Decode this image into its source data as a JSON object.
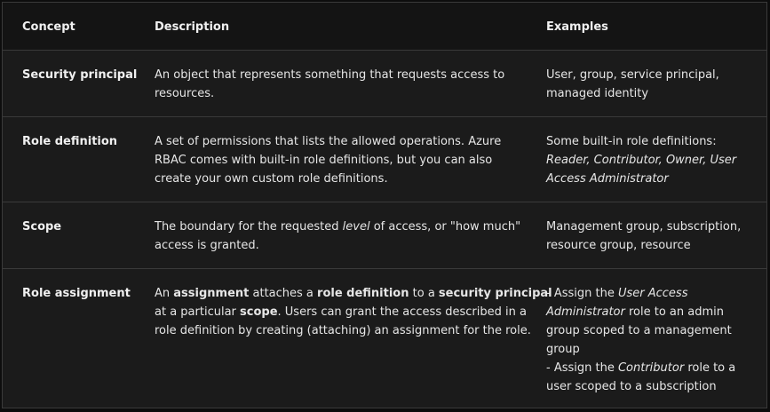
{
  "headers": {
    "concept": "Concept",
    "description": "Description",
    "examples": "Examples"
  },
  "rows": [
    {
      "concept": "Security principal",
      "description": [
        [
          {
            "t": "An object that represents something that requests access to"
          }
        ],
        [
          {
            "t": "resources."
          }
        ]
      ],
      "examples": [
        [
          {
            "t": "User, group, service principal,"
          }
        ],
        [
          {
            "t": "managed identity"
          }
        ]
      ]
    },
    {
      "concept": "Role definition",
      "description": [
        [
          {
            "t": "A set of permissions that lists the allowed operations. Azure"
          }
        ],
        [
          {
            "t": "RBAC comes with built-in role definitions, but you can also"
          }
        ],
        [
          {
            "t": "create your own custom role definitions."
          }
        ]
      ],
      "examples": [
        [
          {
            "t": "Some built-in role definitions:"
          }
        ],
        [
          {
            "t": "Reader, Contributor, Owner, User",
            "s": "i"
          }
        ],
        [
          {
            "t": "Access Administrator",
            "s": "i"
          }
        ]
      ]
    },
    {
      "concept": "Scope",
      "description": [
        [
          {
            "t": "The boundary for the requested "
          },
          {
            "t": "level",
            "s": "i"
          },
          {
            "t": " of access, or \"how much\""
          }
        ],
        [
          {
            "t": "access is granted."
          }
        ]
      ],
      "examples": [
        [
          {
            "t": "Management group, subscription,"
          }
        ],
        [
          {
            "t": "resource group, resource"
          }
        ]
      ]
    },
    {
      "concept": "Role assignment",
      "description": [
        [
          {
            "t": "An "
          },
          {
            "t": "assignment",
            "s": "b"
          },
          {
            "t": " attaches a "
          },
          {
            "t": "role definition",
            "s": "b"
          },
          {
            "t": " to a "
          },
          {
            "t": "security principal",
            "s": "b"
          }
        ],
        [
          {
            "t": "at a particular "
          },
          {
            "t": "scope",
            "s": "b"
          },
          {
            "t": ". Users can grant the access described in a"
          }
        ],
        [
          {
            "t": "role definition by creating (attaching) an assignment for the role."
          }
        ]
      ],
      "examples": [
        [
          {
            "t": "- Assign the "
          },
          {
            "t": "User Access",
            "s": "i"
          }
        ],
        [
          {
            "t": "Administrator",
            "s": "i"
          },
          {
            "t": " role to an admin"
          }
        ],
        [
          {
            "t": "group scoped to a management"
          }
        ],
        [
          {
            "t": "group"
          }
        ],
        [
          {
            "t": "- Assign the "
          },
          {
            "t": "Contributor",
            "s": "i"
          },
          {
            "t": " role to a"
          }
        ],
        [
          {
            "t": "user scoped to a subscription"
          }
        ]
      ]
    }
  ]
}
